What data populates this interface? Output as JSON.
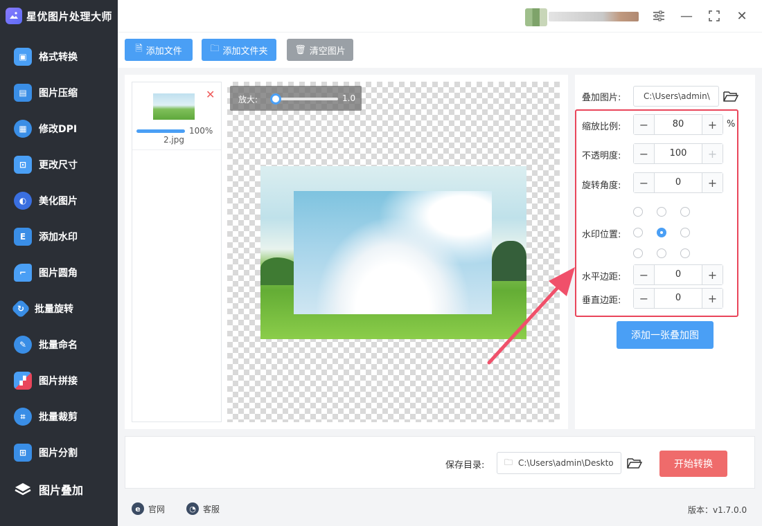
{
  "app": {
    "title": "星优图片处理大师"
  },
  "sidebar": {
    "items": [
      {
        "label": "格式转换",
        "icon": "image-convert-icon",
        "color": "#4a9ff5"
      },
      {
        "label": "图片压缩",
        "icon": "image-compress-icon",
        "color": "#4a9ff5"
      },
      {
        "label": "修改DPI",
        "icon": "dpi-icon",
        "color": "#4a9ff5"
      },
      {
        "label": "更改尺寸",
        "icon": "resize-icon",
        "color": "#4a9ff5"
      },
      {
        "label": "美化图片",
        "icon": "beautify-icon",
        "color": "#4a9ff5"
      },
      {
        "label": "添加水印",
        "icon": "watermark-icon",
        "color": "#4a9ff5"
      },
      {
        "label": "图片圆角",
        "icon": "rounded-corner-icon",
        "color": "#4a9ff5"
      },
      {
        "label": "批量旋转",
        "icon": "rotate-icon",
        "color": "#4a9ff5"
      },
      {
        "label": "批量命名",
        "icon": "rename-icon",
        "color": "#4a9ff5"
      },
      {
        "label": "图片拼接",
        "icon": "puzzle-icon",
        "color": "#4a9ff5"
      },
      {
        "label": "批量裁剪",
        "icon": "crop-icon",
        "color": "#4a9ff5"
      },
      {
        "label": "图片分割",
        "icon": "split-icon",
        "color": "#4a9ff5"
      },
      {
        "label": "图片叠加",
        "icon": "layers-icon",
        "color": "#4a9ff5"
      }
    ],
    "active_index": 12
  },
  "toolbar": {
    "add_file": "添加文件",
    "add_folder": "添加文件夹",
    "clear": "清空图片"
  },
  "file_list": {
    "items": [
      {
        "name": "2.jpg",
        "progress": "100%"
      }
    ]
  },
  "preview": {
    "zoom_label": "放大:",
    "zoom_value": "1.0"
  },
  "settings": {
    "overlay_image_label": "叠加图片:",
    "overlay_image_path": "C:\\Users\\admin\\",
    "scale_label": "缩放比例:",
    "scale_value": "80",
    "scale_unit": "%",
    "opacity_label": "不透明度:",
    "opacity_value": "100",
    "rotation_label": "旋转角度:",
    "rotation_value": "0",
    "position_label": "水印位置:",
    "position_selected": "center",
    "h_margin_label": "水平边距:",
    "h_margin_value": "0",
    "v_margin_label": "垂直边距:",
    "v_margin_value": "0",
    "add_overlay_button": "添加一张叠加图"
  },
  "output": {
    "save_label": "保存目录:",
    "save_path": "C:\\Users\\admin\\Deskto",
    "start_button": "开始转换"
  },
  "footer": {
    "website": "官网",
    "support": "客服",
    "version": "版本：v1.7.0.0"
  },
  "colors": {
    "accent": "#4a9ff5",
    "danger": "#ef6b6b",
    "highlight_box": "#e9455a",
    "sidebar_bg": "#2b2f36"
  }
}
